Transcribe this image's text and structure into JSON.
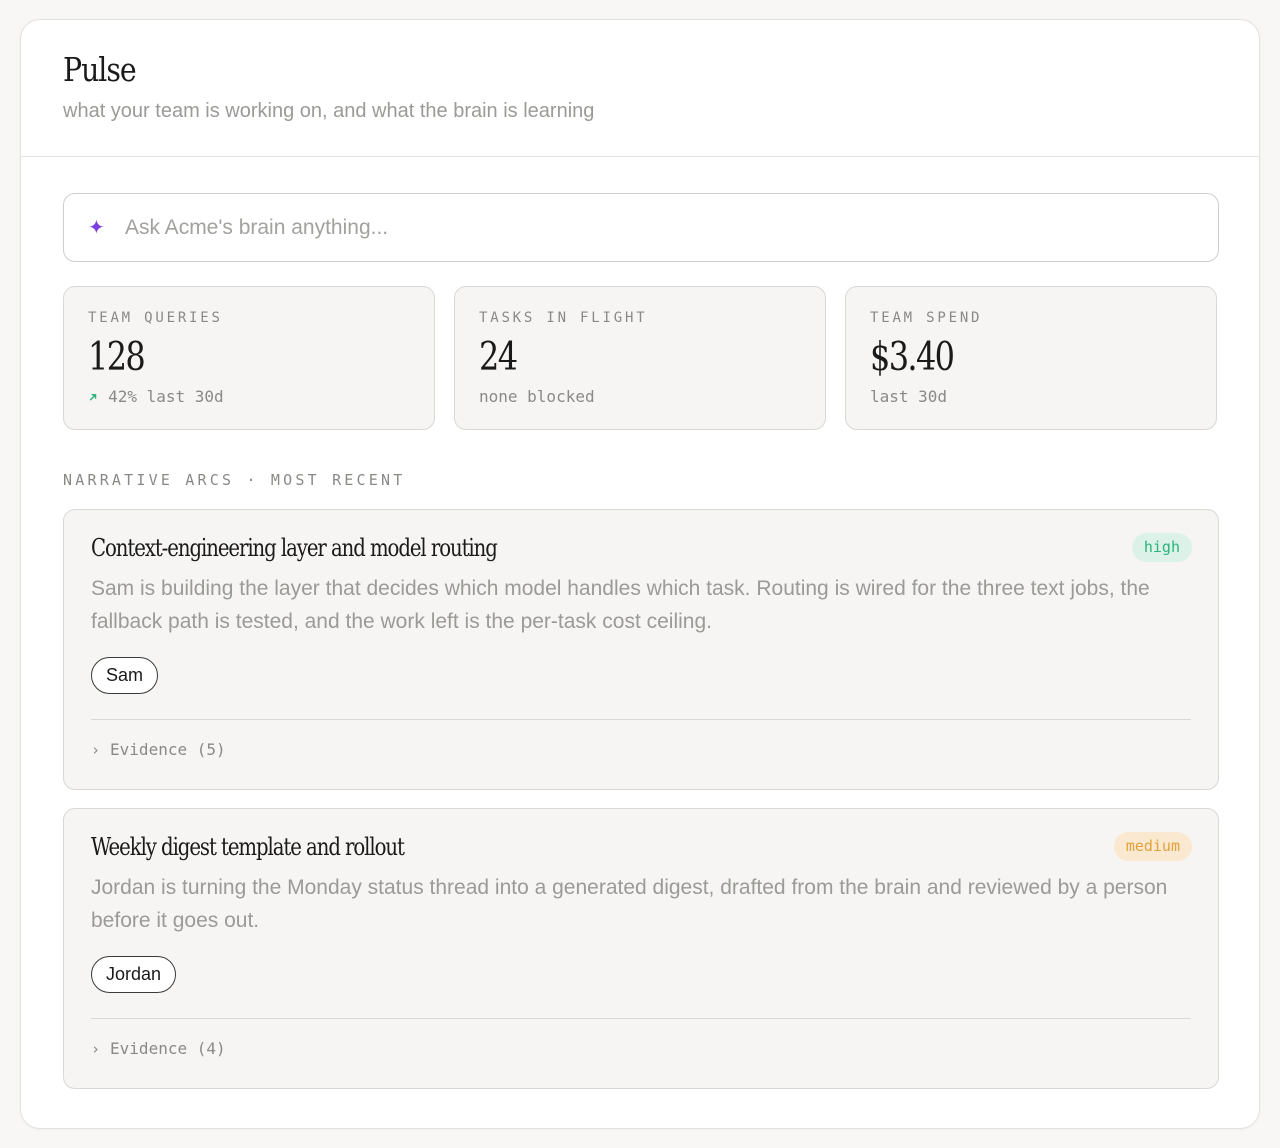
{
  "header": {
    "title": "Pulse",
    "subtitle": "what your team is working on, and what the brain is learning"
  },
  "search": {
    "icon": "sparkle-icon",
    "placeholder": "Ask Acme's brain anything..."
  },
  "stats": [
    {
      "label": "TEAM QUERIES",
      "value": "128",
      "sub": "42% last 30d",
      "trend_icon": "trend-up-icon",
      "trend_color": "#2bb37b"
    },
    {
      "label": "TASKS IN FLIGHT",
      "value": "24",
      "sub": "none blocked"
    },
    {
      "label": "TEAM SPEND",
      "value": "$3.40",
      "sub": "last 30d"
    }
  ],
  "section_label": "NARRATIVE ARCS · MOST RECENT",
  "arcs": [
    {
      "title": "Context-engineering layer and model routing",
      "badge": "high",
      "badge_color": "#2bb37b",
      "description": "Sam is building the layer that decides which model handles which task. Routing is wired for the three text jobs, the fallback path is tested, and the work left is the per-task cost ceiling.",
      "person": "Sam",
      "evidence": "Evidence (5)"
    },
    {
      "title": "Weekly digest template and rollout",
      "badge": "medium",
      "badge_color": "#e0a23a",
      "description": "Jordan is turning the Monday status thread into a generated digest, drafted from the brain and reviewed by a person before it goes out.",
      "person": "Jordan",
      "evidence": "Evidence (4)"
    }
  ],
  "colors": {
    "accent": "#7b3fe0",
    "background": "#f8f7f5",
    "card": "#ffffff"
  }
}
